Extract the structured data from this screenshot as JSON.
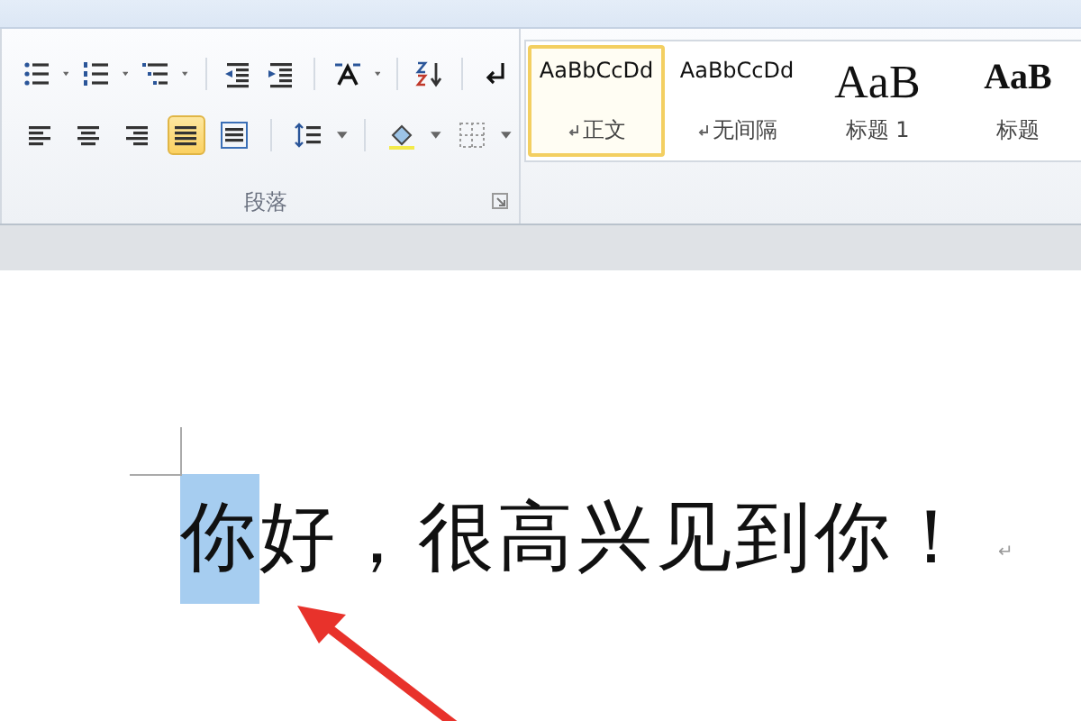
{
  "ribbon": {
    "paragraph_group": {
      "label": "段落",
      "alignment": [
        {
          "kind": "left",
          "selected": false
        },
        {
          "kind": "center",
          "selected": false
        },
        {
          "kind": "right",
          "selected": false
        },
        {
          "kind": "justify",
          "selected": true
        },
        {
          "kind": "distributed",
          "selected": false
        }
      ]
    },
    "styles": [
      {
        "preview": "AaBbCcDd",
        "name": "正文",
        "kind": "body",
        "paragraph_mark": true,
        "selected": true
      },
      {
        "preview": "AaBbCcDd",
        "name": "无间隔",
        "kind": "body",
        "paragraph_mark": true,
        "selected": false
      },
      {
        "preview": "AaB",
        "name": "标题 1",
        "kind": "heading1",
        "paragraph_mark": false,
        "selected": false
      },
      {
        "preview": "AaB",
        "name": "标题",
        "kind": "heading2",
        "paragraph_mark": false,
        "selected": false
      }
    ]
  },
  "document": {
    "segments": [
      {
        "text": "你",
        "selected": true
      },
      {
        "text": "好，很高兴见到你！",
        "selected": false
      }
    ],
    "paragraph_mark": "↵"
  }
}
